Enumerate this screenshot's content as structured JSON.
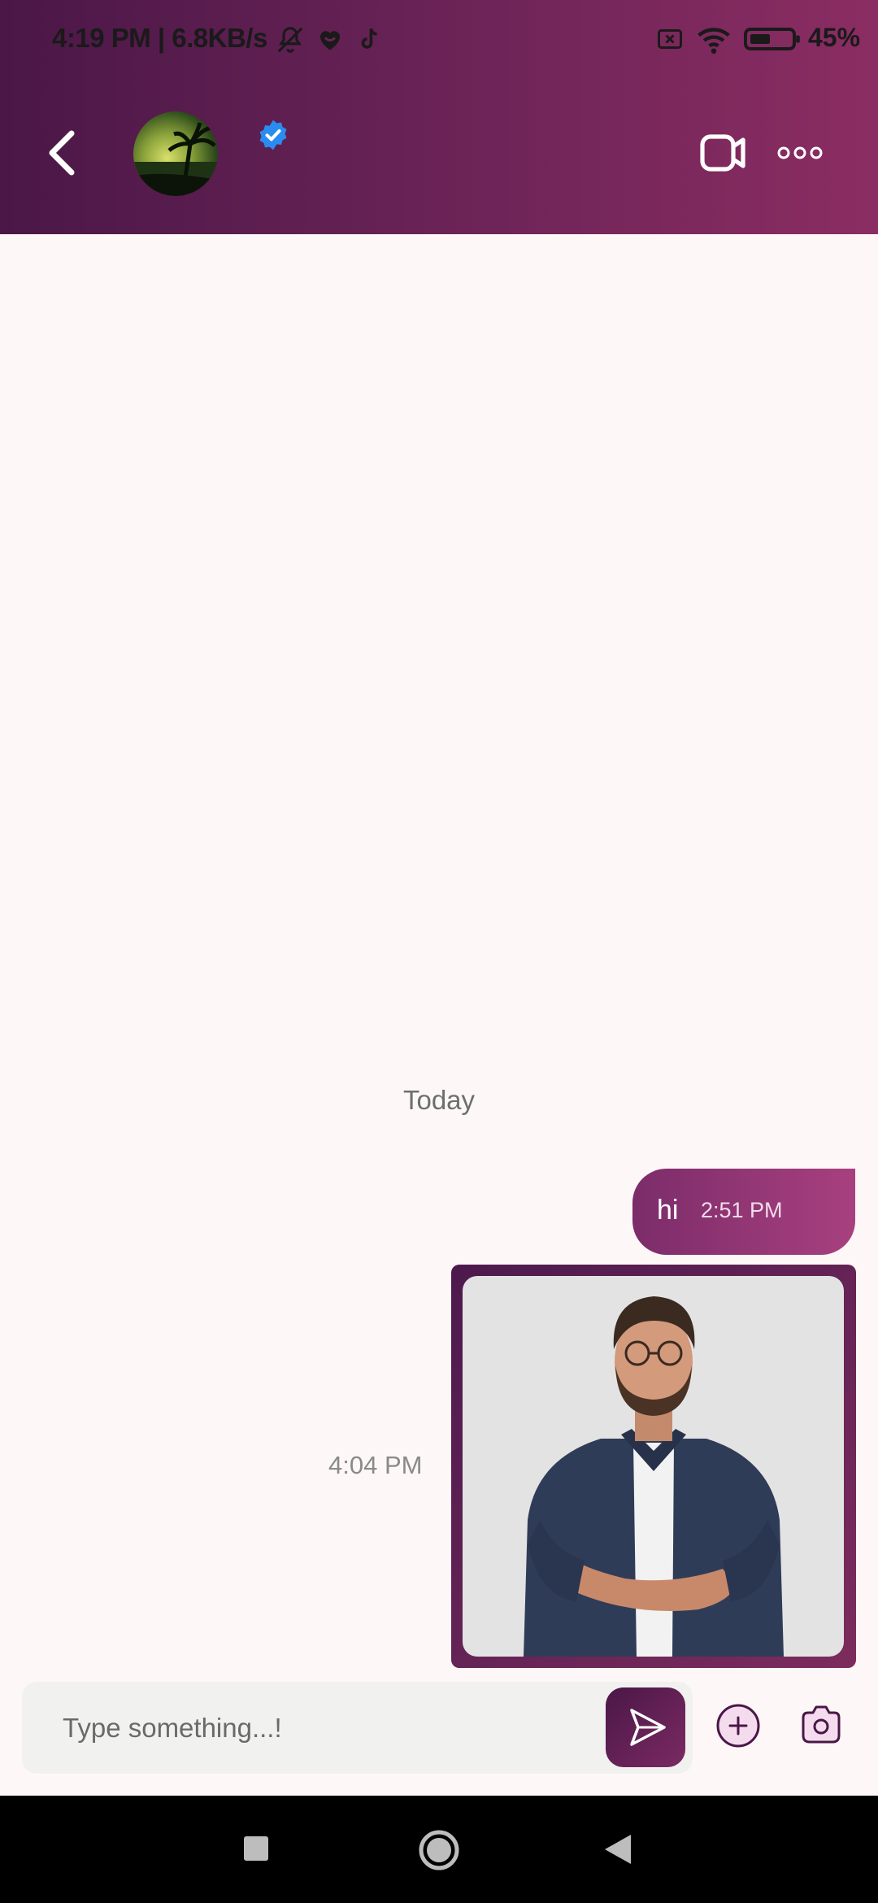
{
  "status_bar": {
    "time_speed": "4:19 PM | 6.8KB/s",
    "battery": "45%",
    "icons": [
      "mute-icon",
      "heart-app-icon",
      "tiktok-icon",
      "sim-off-icon",
      "wifi-icon",
      "battery-icon"
    ]
  },
  "header": {
    "back_icon": "chevron-left-icon",
    "avatar": "contact-avatar",
    "verified_icon": "verified-badge-icon",
    "video_icon": "video-call-icon",
    "more_icon": "more-options-icon"
  },
  "chat": {
    "date_separator": "Today",
    "messages": [
      {
        "type": "text",
        "text": "hi",
        "time": "2:51 PM"
      },
      {
        "type": "image",
        "time": "4:04 PM"
      }
    ]
  },
  "composer": {
    "placeholder": "Type something...!",
    "send_icon": "send-icon",
    "add_icon": "add-icon",
    "camera_icon": "camera-icon"
  },
  "nav_bar": {
    "buttons": [
      "recents-icon",
      "home-icon",
      "back-triangle-icon"
    ]
  },
  "colors": {
    "header_start": "#4a1747",
    "header_end": "#8b2d63",
    "bubble_start": "#7c2c6a",
    "bubble_end": "#a8407f",
    "background": "#fdf8f7",
    "verified_blue": "#2b8cf0"
  }
}
